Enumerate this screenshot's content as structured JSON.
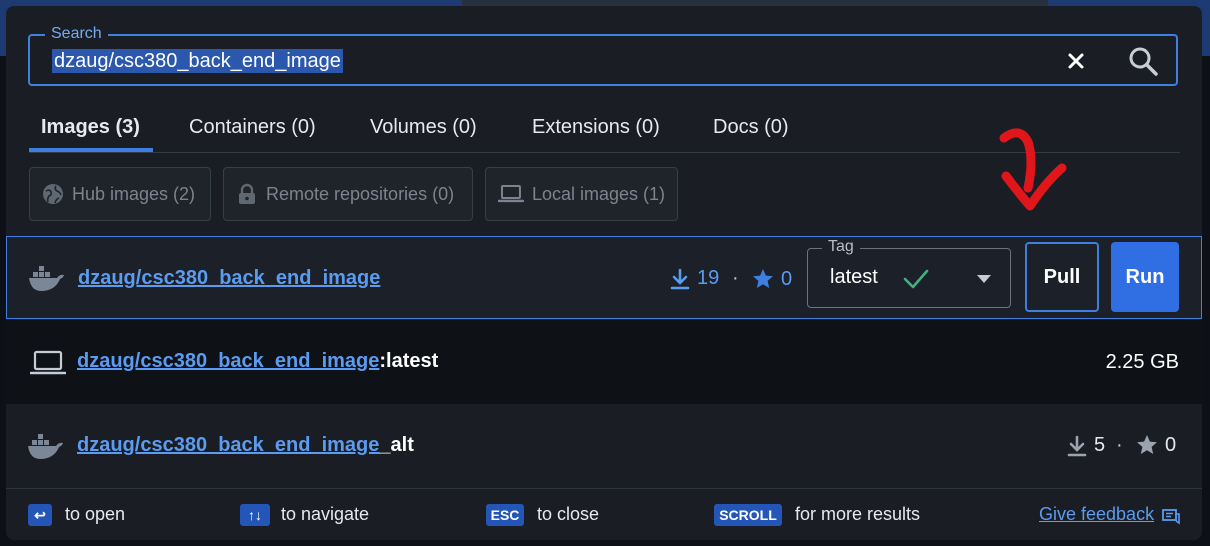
{
  "search": {
    "label": "Search",
    "value": "dzaug/csc380_back_end_image"
  },
  "tabs": [
    {
      "label": "Images (3)",
      "active": true
    },
    {
      "label": "Containers (0)"
    },
    {
      "label": "Volumes (0)"
    },
    {
      "label": "Extensions (0)"
    },
    {
      "label": "Docs (0)"
    }
  ],
  "filters": [
    {
      "label": "Hub images (2)",
      "icon": "globe-icon"
    },
    {
      "label": "Remote repositories (0)",
      "icon": "lock-icon"
    },
    {
      "label": "Local images (1)",
      "icon": "laptop-icon"
    }
  ],
  "results": [
    {
      "name": "dzaug/csc380_back_end_image",
      "icon": "docker-whale-icon",
      "pulls": "19",
      "stars": "0",
      "tag_label": "Tag",
      "tag_value": "latest",
      "pull_label": "Pull",
      "run_label": "Run"
    },
    {
      "name": "dzaug/csc380_back_end_image",
      "suffix": ":latest",
      "icon": "laptop-icon",
      "size": "2.25 GB"
    },
    {
      "name": "dzaug/csc380_back_end_image",
      "suffix": "_alt",
      "icon": "docker-whale-icon",
      "pulls": "5",
      "stars": "0"
    }
  ],
  "footer": {
    "hints": [
      {
        "key": "↩",
        "text": "to open"
      },
      {
        "key": "↑↓",
        "text": "to navigate"
      },
      {
        "key": "ESC",
        "text": "to close"
      },
      {
        "key": "SCROLL",
        "text": "for more results"
      }
    ],
    "feedback": "Give feedback"
  },
  "colors": {
    "accent": "#3f7fe0",
    "link": "#5b9bf0",
    "check": "#3fb27f",
    "annotation_arrow": "#e0161b"
  }
}
